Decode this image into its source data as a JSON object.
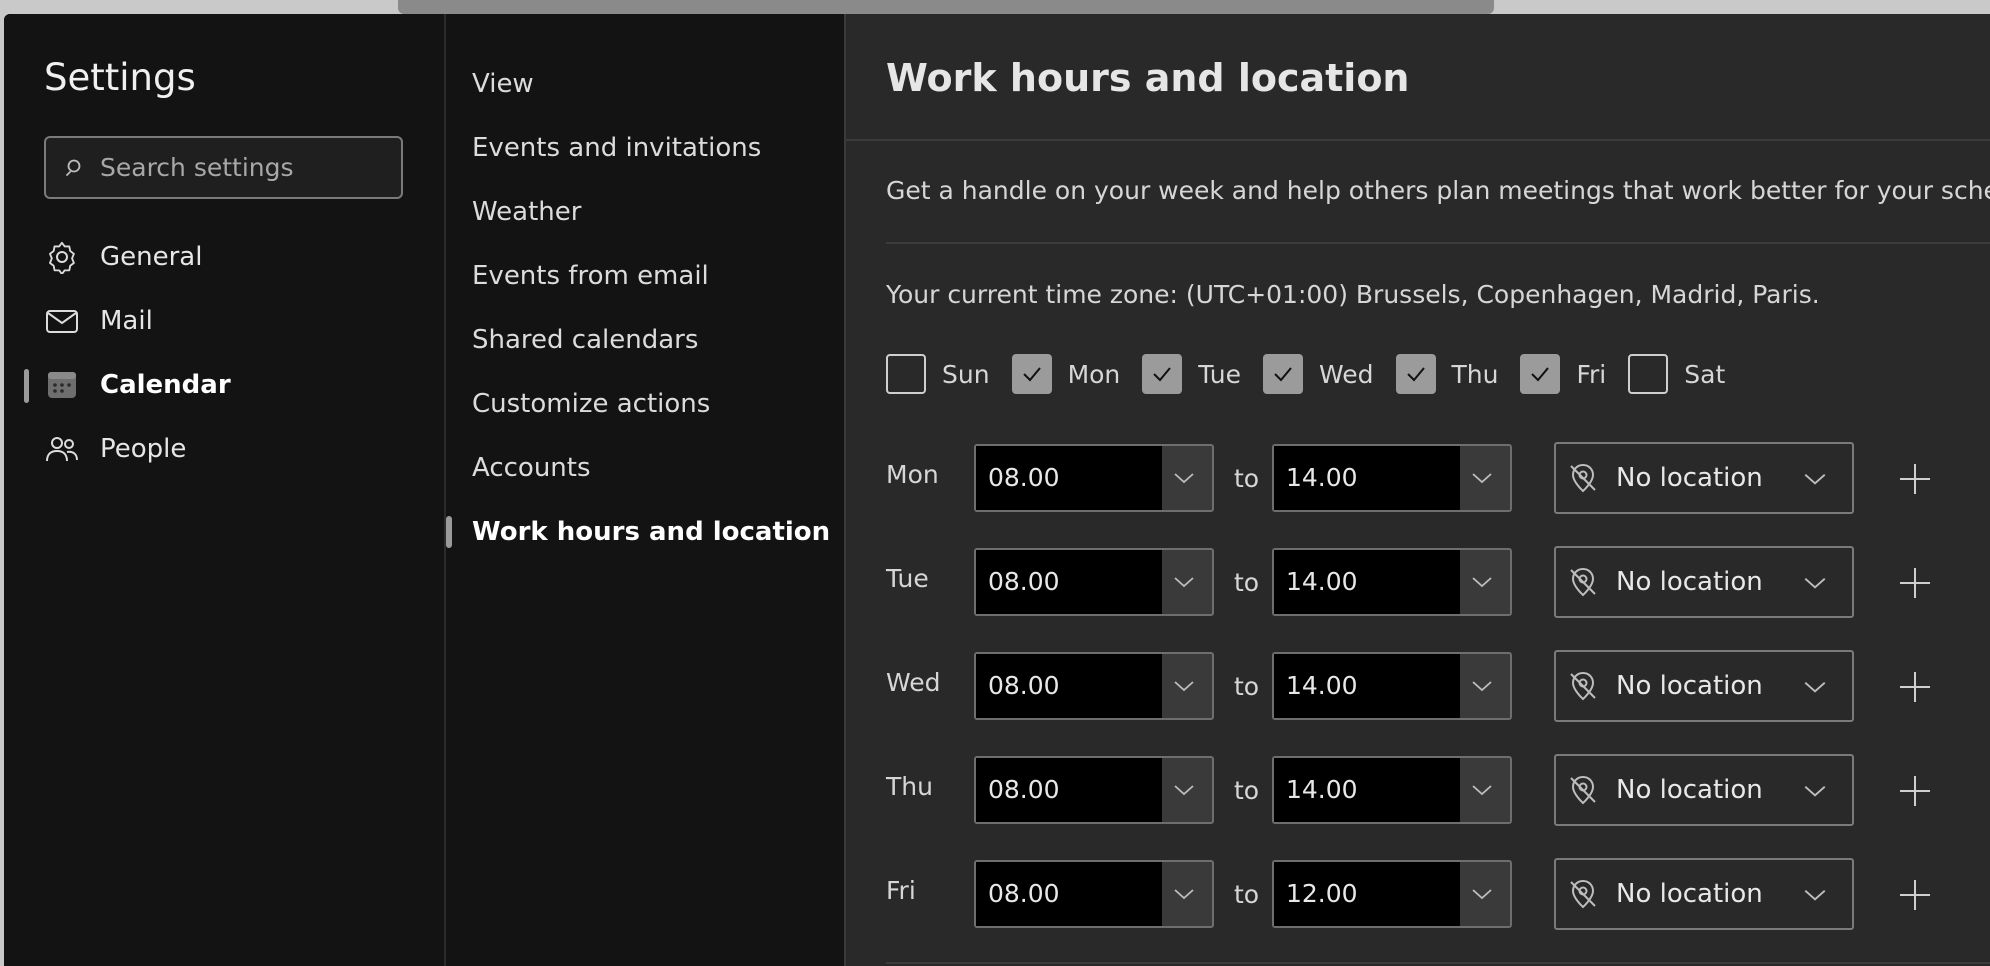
{
  "colors": {
    "window_bg": "#131313",
    "content_bg": "#292929",
    "accent_indicator": "#9a9a9a",
    "checked_bg": "#9b9b9b"
  },
  "sidebar": {
    "title": "Settings",
    "search_placeholder": "Search settings",
    "items": [
      {
        "label": "General",
        "icon": "gear-icon",
        "active": false
      },
      {
        "label": "Mail",
        "icon": "mail-icon",
        "active": false
      },
      {
        "label": "Calendar",
        "icon": "calendar-icon",
        "active": true
      },
      {
        "label": "People",
        "icon": "people-icon",
        "active": false
      }
    ]
  },
  "subnav": {
    "items": [
      {
        "label": "View"
      },
      {
        "label": "Events and invitations"
      },
      {
        "label": "Weather"
      },
      {
        "label": "Events from email"
      },
      {
        "label": "Shared calendars"
      },
      {
        "label": "Customize actions"
      },
      {
        "label": "Accounts"
      },
      {
        "label": "Work hours and location",
        "active": true
      }
    ]
  },
  "main": {
    "title": "Work hours and location",
    "description": "Get a handle on your week and help others plan meetings that work better for your sched",
    "timezone": "Your current time zone: (UTC+01:00) Brussels, Copenhagen, Madrid, Paris.",
    "days": [
      {
        "label": "Sun",
        "checked": false
      },
      {
        "label": "Mon",
        "checked": true
      },
      {
        "label": "Tue",
        "checked": true
      },
      {
        "label": "Wed",
        "checked": true
      },
      {
        "label": "Thu",
        "checked": true
      },
      {
        "label": "Fri",
        "checked": true
      },
      {
        "label": "Sat",
        "checked": false
      }
    ],
    "to_label": "to",
    "schedule": [
      {
        "day": "Mon",
        "start": "08.00",
        "end": "14.00",
        "location": "No location"
      },
      {
        "day": "Tue",
        "start": "08.00",
        "end": "14.00",
        "location": "No location"
      },
      {
        "day": "Wed",
        "start": "08.00",
        "end": "14.00",
        "location": "No location"
      },
      {
        "day": "Thu",
        "start": "08.00",
        "end": "14.00",
        "location": "No location"
      },
      {
        "day": "Fri",
        "start": "08.00",
        "end": "12.00",
        "location": "No location"
      }
    ]
  }
}
